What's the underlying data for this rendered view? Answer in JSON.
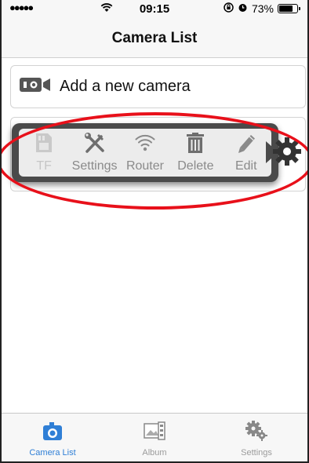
{
  "status_bar": {
    "signal": "●●●●●",
    "time": "09:15",
    "battery_percent": "73%"
  },
  "nav": {
    "title": "Camera List"
  },
  "list": {
    "add_camera_label": "Add a new camera"
  },
  "action_popup": {
    "items": [
      {
        "label": "TF",
        "icon": "sd-card-icon",
        "enabled": false
      },
      {
        "label": "Settings",
        "icon": "tools-icon",
        "enabled": true
      },
      {
        "label": "Router",
        "icon": "wifi-icon",
        "enabled": true
      },
      {
        "label": "Delete",
        "icon": "trash-icon",
        "enabled": true
      },
      {
        "label": "Edit",
        "icon": "pencil-icon",
        "enabled": true
      }
    ]
  },
  "tab_bar": {
    "tabs": [
      {
        "label": "Camera List",
        "icon": "camera-icon",
        "active": true
      },
      {
        "label": "Album",
        "icon": "album-icon",
        "active": false
      },
      {
        "label": "Settings",
        "icon": "gears-icon",
        "active": false
      }
    ]
  },
  "colors": {
    "accent": "#2f7fd6",
    "highlight_ellipse": "#e8101a",
    "popup_frame": "#4a4a4a"
  }
}
